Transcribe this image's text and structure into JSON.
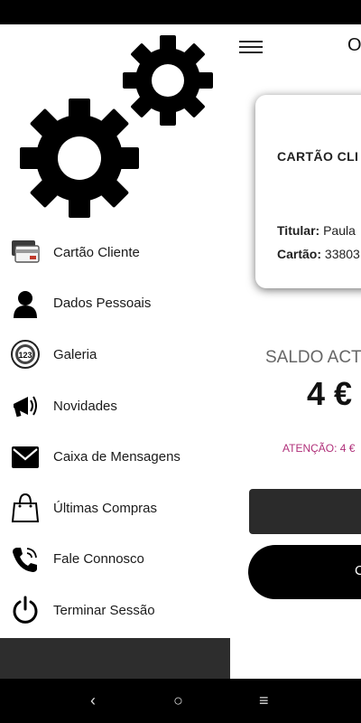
{
  "main": {
    "app_title": "O",
    "card": {
      "title": "CARTÃO CLI",
      "titular_label": "Titular:",
      "titular_value": " Paula",
      "cartao_label": "Cartão:",
      "cartao_value": " 33803"
    },
    "saldo_label": "SALDO ACT",
    "saldo_value": "4 €",
    "atencao": "ATENÇÃO: 4 €",
    "button_label": "C"
  },
  "drawer": {
    "items": [
      {
        "label": "Cartão Cliente",
        "icon": "card-icon"
      },
      {
        "label": "Dados Pessoais",
        "icon": "person-icon"
      },
      {
        "label": "Galeria",
        "icon": "gallery-icon"
      },
      {
        "label": "Novidades",
        "icon": "megaphone-icon"
      },
      {
        "label": "Caixa de Mensagens",
        "icon": "envelope-icon"
      },
      {
        "label": "Últimas Compras",
        "icon": "shopping-bag-icon"
      },
      {
        "label": "Fale Connosco",
        "icon": "phone-icon"
      },
      {
        "label": "Terminar Sessão",
        "icon": "power-icon"
      }
    ]
  },
  "navbar": {
    "back": "‹",
    "home": "○",
    "recents": "≡"
  }
}
